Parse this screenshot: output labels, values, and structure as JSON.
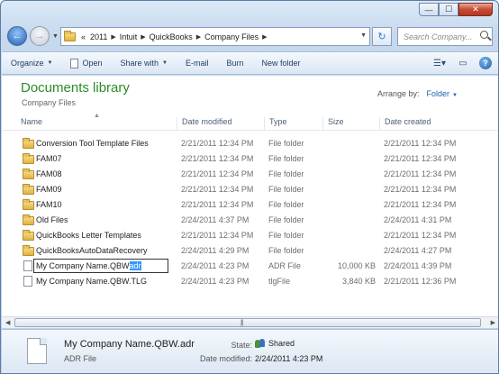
{
  "window": {
    "controls": {
      "minimize": "—",
      "maximize": "☐",
      "close": "✕"
    }
  },
  "address": {
    "prefix": "«",
    "crumbs": [
      "2011",
      "Intuit",
      "QuickBooks",
      "Company Files"
    ],
    "search_placeholder": "Search Company..."
  },
  "toolbar": {
    "organize": "Organize",
    "open": "Open",
    "share_with": "Share with",
    "email": "E-mail",
    "burn": "Burn",
    "new_folder": "New folder",
    "help": "?"
  },
  "library": {
    "title": "Documents library",
    "subtitle": "Company Files",
    "arrange_label": "Arrange by:",
    "arrange_value": "Folder"
  },
  "columns": {
    "name": "Name",
    "date_modified": "Date modified",
    "type": "Type",
    "size": "Size",
    "date_created": "Date created"
  },
  "rows": [
    {
      "name": "Conversion Tool Template Files",
      "modified": "2/21/2011 12:34 PM",
      "type": "File folder",
      "size": "",
      "created": "2/21/2011 12:34 PM",
      "kind": "folder"
    },
    {
      "name": "FAM07",
      "modified": "2/21/2011 12:34 PM",
      "type": "File folder",
      "size": "",
      "created": "2/21/2011 12:34 PM",
      "kind": "folder"
    },
    {
      "name": "FAM08",
      "modified": "2/21/2011 12:34 PM",
      "type": "File folder",
      "size": "",
      "created": "2/21/2011 12:34 PM",
      "kind": "folder"
    },
    {
      "name": "FAM09",
      "modified": "2/21/2011 12:34 PM",
      "type": "File folder",
      "size": "",
      "created": "2/21/2011 12:34 PM",
      "kind": "folder"
    },
    {
      "name": "FAM10",
      "modified": "2/21/2011 12:34 PM",
      "type": "File folder",
      "size": "",
      "created": "2/21/2011 12:34 PM",
      "kind": "folder"
    },
    {
      "name": "Old Files",
      "modified": "2/24/2011 4:37 PM",
      "type": "File folder",
      "size": "",
      "created": "2/24/2011 4:31 PM",
      "kind": "folder"
    },
    {
      "name": "QuickBooks Letter Templates",
      "modified": "2/21/2011 12:34 PM",
      "type": "File folder",
      "size": "",
      "created": "2/21/2011 12:34 PM",
      "kind": "folder"
    },
    {
      "name": "QuickBooksAutoDataRecovery",
      "modified": "2/24/2011 4:29 PM",
      "type": "File folder",
      "size": "",
      "created": "2/24/2011 4:27 PM",
      "kind": "folder"
    },
    {
      "name": "My Company Name.QBW",
      "name_selected": "adr",
      "modified": "2/24/2011 4:23 PM",
      "type": "ADR File",
      "size": "10,000 KB",
      "created": "2/24/2011 4:39 PM",
      "kind": "renaming"
    },
    {
      "name": "My Company Name.QBW.TLG",
      "modified": "2/24/2011 4:23 PM",
      "type": "tlgFile",
      "size": "3,840 KB",
      "created": "2/21/2011 12:36 PM",
      "kind": "file"
    }
  ],
  "details": {
    "name": "My Company Name.QBW.adr",
    "type": "ADR File",
    "state_label": "State:",
    "state_value": "Shared",
    "modified_label": "Date modified:",
    "modified_value": "2/24/2011 4:23 PM"
  }
}
